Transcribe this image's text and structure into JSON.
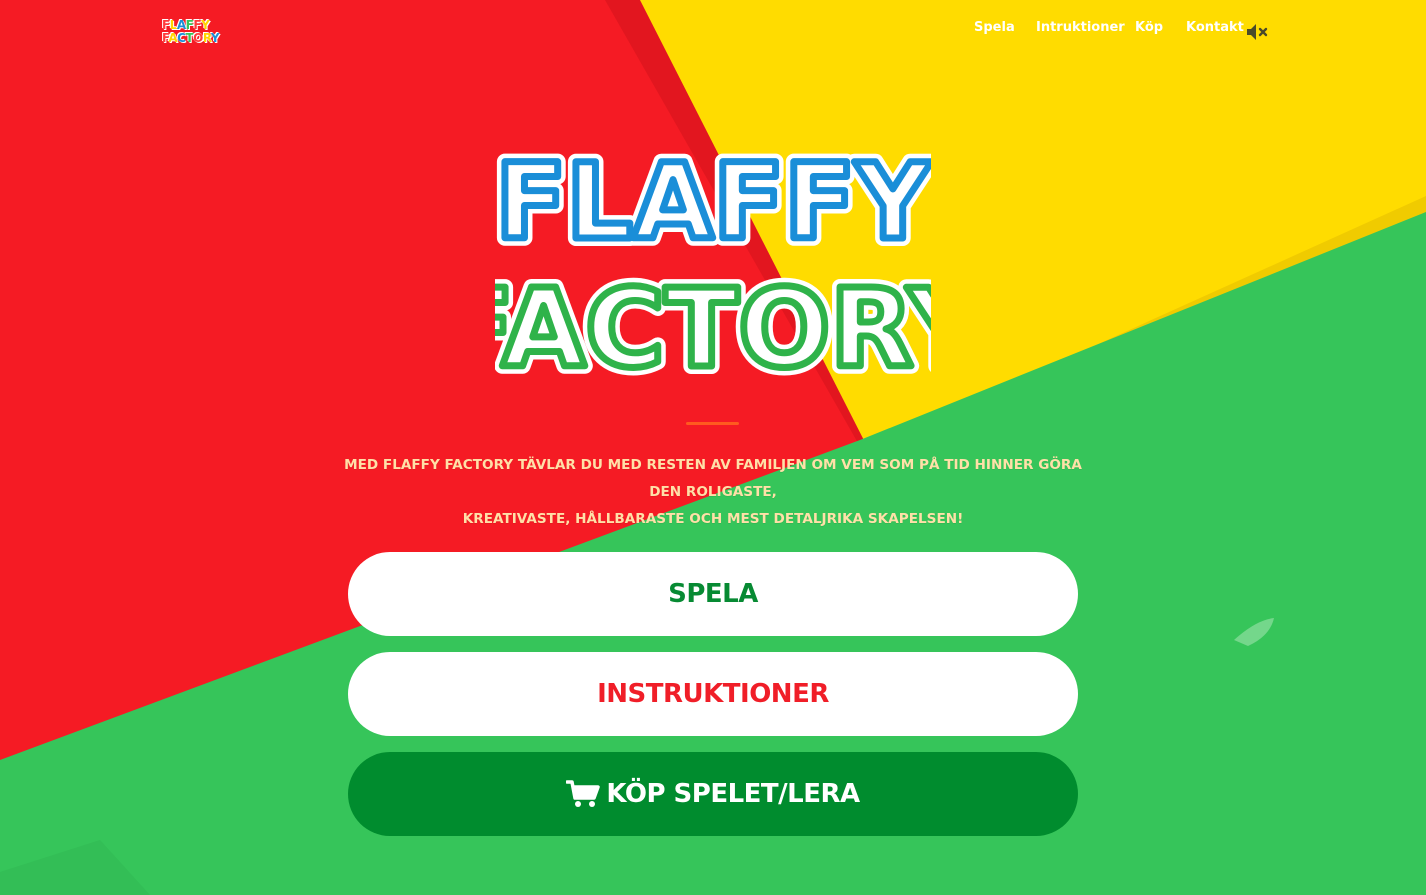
{
  "header": {
    "logo_line1": "FLAFFY",
    "logo_line2": "FACTORY",
    "nav": [
      {
        "label": "Spela"
      },
      {
        "label": "Intruktioner"
      },
      {
        "label": "Köp"
      },
      {
        "label": "Kontakt"
      }
    ],
    "sound_icon": "speaker-muted-icon"
  },
  "hero": {
    "logo_line1": "FLAFFY",
    "logo_line2": "FACTORY",
    "tagline_line1": "MED FLAFFY FACTORY TÄVLAR DU MED RESTEN AV FAMILJEN OM VEM SOM PÅ TID HINNER GÖRA DEN ROLIGASTE,",
    "tagline_line2": "KREATIVASTE, HÅLLBARASTE OCH MEST DETALJRIKA SKAPELSEN!"
  },
  "buttons": {
    "play": "SPELA",
    "instructions": "INSTRUKTIONER",
    "buy": "KÖP SPELET/LERA",
    "buy_icon": "shopping-cart-icon"
  },
  "colors": {
    "red": "#f51b24",
    "yellow": "#ffdc00",
    "green": "#36c55a",
    "dark_green": "#008c2e"
  }
}
